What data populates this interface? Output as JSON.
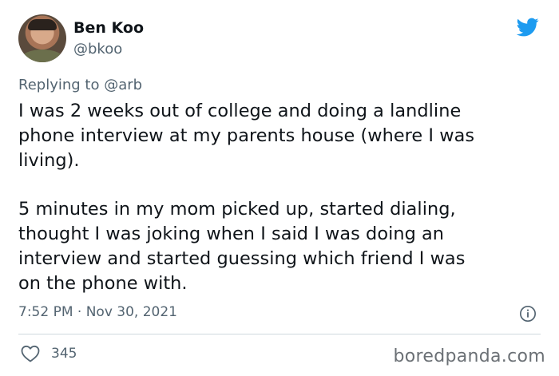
{
  "author": {
    "display_name": "Ben Koo",
    "handle": "@bkoo"
  },
  "reply": {
    "prefix": "Replying to ",
    "mention": "@arb"
  },
  "tweet": {
    "lines_p1": [
      "I was 2 weeks out of college and doing a landline",
      "phone interview at my parents house (where I was",
      "living)."
    ],
    "lines_p2": [
      "5 minutes in my mom picked up, started dialing,",
      "thought I was joking when I said I was doing an",
      "interview and started guessing which friend I was",
      "on the phone with."
    ],
    "timestamp": "7:52 PM · Nov 30, 2021"
  },
  "engagement": {
    "likes": "345"
  },
  "watermark": "boredpanda.com",
  "icons": {
    "brand": "twitter-bird-icon",
    "info": "info-icon",
    "like": "heart-icon"
  },
  "colors": {
    "twitter_blue": "#1d9bf0",
    "text": "#0f1419",
    "secondary": "#536471"
  }
}
